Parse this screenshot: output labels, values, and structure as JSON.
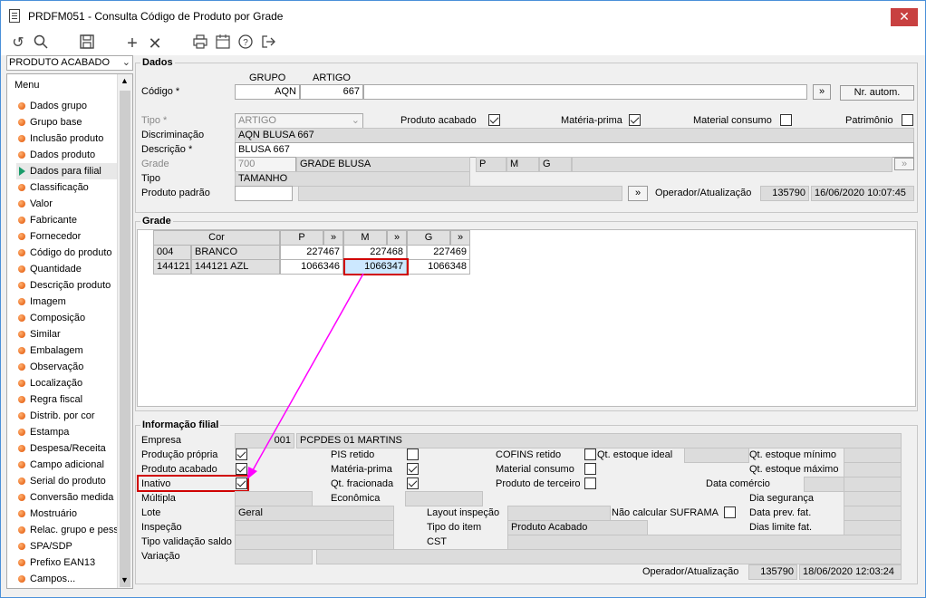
{
  "window": {
    "title": "PRDFM051 - Consulta Código de Produto por Grade",
    "close": "✕"
  },
  "toolbar": {
    "icons": [
      "undo-icon",
      "search-icon",
      "save-icon",
      "add-icon",
      "delete-icon",
      "print-icon",
      "calendar-icon",
      "help-icon",
      "exit-icon"
    ]
  },
  "sidebar": {
    "combo_value": "PRODUTO ACABADO",
    "menu_title": "Menu",
    "items": [
      {
        "label": "Dados grupo",
        "type": "dot"
      },
      {
        "label": "Grupo base",
        "type": "dot"
      },
      {
        "label": "Inclusão produto",
        "type": "dot"
      },
      {
        "label": "Dados produto",
        "type": "dot"
      },
      {
        "label": "Dados para filial",
        "type": "tri"
      },
      {
        "label": "Classificação",
        "type": "dot"
      },
      {
        "label": "Valor",
        "type": "dot"
      },
      {
        "label": "Fabricante",
        "type": "dot"
      },
      {
        "label": "Fornecedor",
        "type": "dot"
      },
      {
        "label": "Código do produto",
        "type": "dot"
      },
      {
        "label": "Quantidade",
        "type": "dot"
      },
      {
        "label": "Descrição produto",
        "type": "dot"
      },
      {
        "label": "Imagem",
        "type": "dot"
      },
      {
        "label": "Composição",
        "type": "dot"
      },
      {
        "label": "Similar",
        "type": "dot"
      },
      {
        "label": "Embalagem",
        "type": "dot"
      },
      {
        "label": "Observação",
        "type": "dot"
      },
      {
        "label": "Localização",
        "type": "dot"
      },
      {
        "label": "Regra fiscal",
        "type": "dot"
      },
      {
        "label": "Distrib. por cor",
        "type": "dot"
      },
      {
        "label": "Estampa",
        "type": "dot"
      },
      {
        "label": "Despesa/Receita",
        "type": "dot"
      },
      {
        "label": "Campo adicional",
        "type": "dot"
      },
      {
        "label": "Serial do produto",
        "type": "dot"
      },
      {
        "label": "Conversão medida",
        "type": "dot"
      },
      {
        "label": "Mostruário",
        "type": "dot"
      },
      {
        "label": "Relac. grupo e pess",
        "type": "dot"
      },
      {
        "label": "SPA/SDP",
        "type": "dot"
      },
      {
        "label": "Prefixo EAN13",
        "type": "dot"
      },
      {
        "label": "Campos...",
        "type": "dot"
      }
    ]
  },
  "dados": {
    "section": "Dados",
    "grupo_hdr": "GRUPO",
    "artigo_hdr": "ARTIGO",
    "codigo_lbl": "Código *",
    "grupo": "AQN",
    "artigo": "667",
    "arrow_btn": "»",
    "nr_autom": "Nr. autom.",
    "tipo_lbl": "Tipo *",
    "tipo": "ARTIGO",
    "produto_acabado": "Produto acabado",
    "materia_prima": "Matéria-prima",
    "material_consumo": "Material consumo",
    "patrimonio": "Patrimônio",
    "discriminacao_lbl": "Discriminação",
    "discriminacao": "AQN BLUSA 667",
    "descricao_lbl": "Descrição *",
    "descricao": "BLUSA 667",
    "grade_lbl": "Grade",
    "grade_code": "700",
    "grade_name": "GRADE BLUSA",
    "grade_p": "P",
    "grade_m": "M",
    "grade_g": "G",
    "tipo2_lbl": "Tipo",
    "tipo2": "TAMANHO",
    "produto_padrao_lbl": "Produto padrão",
    "operador_lbl": "Operador/Atualização",
    "operador": "135790",
    "atualizacao": "16/06/2020 10:07:45"
  },
  "grade": {
    "section": "Grade",
    "headers": {
      "cor": "Cor",
      "p": "P",
      "m": "M",
      "g": "G",
      "arrow": "»"
    },
    "rows": [
      {
        "code": "004",
        "name": "BRANCO",
        "p": "227467",
        "m": "227468",
        "g": "227469"
      },
      {
        "code": "144121",
        "name": "144121 AZL",
        "p": "1066346",
        "m": "1066347",
        "g": "1066348"
      }
    ]
  },
  "filial": {
    "section": "Informação filial",
    "empresa_lbl": "Empresa",
    "empresa_code": "001",
    "empresa_name": "PCPDES 01 MARTINS",
    "producao_propria": "Produção própria",
    "pis_retido": "PIS retido",
    "cofins_retido": "COFINS retido",
    "qt_estoque_ideal": "Qt. estoque ideal",
    "qt_estoque_minimo": "Qt. estoque mínimo",
    "produto_acabado": "Produto acabado",
    "materia_prima": "Matéria-prima",
    "material_consumo": "Material consumo",
    "qt_estoque_maximo": "Qt. estoque máximo",
    "inativo": "Inativo",
    "qt_fracionada": "Qt. fracionada",
    "produto_terceiro": "Produto de terceiro",
    "data_comercio": "Data comércio",
    "multipla": "Múltipla",
    "economica": "Econômica",
    "dia_seguranca": "Dia segurança",
    "lote_lbl": "Lote",
    "lote": "Geral",
    "layout_inspecao": "Layout inspeção",
    "nao_calcular_suframa": "Não calcular SUFRAMA",
    "data_prev_fat": "Data prev. fat.",
    "inspecao": "Inspeção",
    "tipo_item_lbl": "Tipo do item",
    "tipo_item": "Produto Acabado",
    "dias_limite_fat": "Dias limite fat.",
    "tipo_validacao_saldo": "Tipo validação saldo",
    "cst": "CST",
    "variacao": "Variação",
    "operador_lbl": "Operador/Atualização",
    "operador": "135790",
    "atualizacao": "18/06/2020 12:03:24"
  },
  "colors": {
    "highlight": "#d00000",
    "annotation_arrow": "#ff00ff",
    "accent": "#4a90d9"
  }
}
